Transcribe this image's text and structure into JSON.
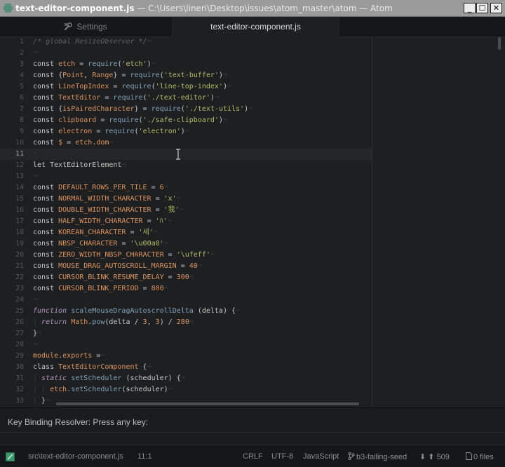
{
  "window": {
    "file_name": "text-editor-component.js",
    "title_rest": " — C:\\Users\\lineri\\Desktop\\issues\\atom_master\\atom — Atom",
    "minimize_glyph": "_",
    "maximize_glyph": "☐",
    "close_glyph": "✕"
  },
  "tabs": [
    {
      "label": "Settings",
      "icon": "wrench-icon",
      "active": false
    },
    {
      "label": "text-editor-component.js",
      "active": true
    }
  ],
  "editor": {
    "current_line": 11,
    "line_numbers": [
      "1",
      "2",
      "3",
      "4",
      "5",
      "6",
      "7",
      "8",
      "9",
      "10",
      "11",
      "12",
      "13",
      "14",
      "15",
      "16",
      "17",
      "18",
      "19",
      "20",
      "21",
      "22",
      "23",
      "24",
      "25",
      "26",
      "27",
      "28",
      "29",
      "30",
      "31",
      "32",
      "33"
    ],
    "lines": [
      [
        [
          "cm",
          "/* global ResizeObserver */"
        ],
        [
          "inv",
          "¬"
        ]
      ],
      [
        [
          "inv",
          "¬"
        ]
      ],
      [
        [
          "pl",
          "const "
        ],
        [
          "var",
          "etch"
        ],
        [
          "pl",
          " = "
        ],
        [
          "fn",
          "require"
        ],
        [
          "pl",
          "("
        ],
        [
          "str",
          "'etch'"
        ],
        [
          "pl",
          ")"
        ],
        [
          "inv",
          "¬"
        ]
      ],
      [
        [
          "pl",
          "const {"
        ],
        [
          "var",
          "Point"
        ],
        [
          "pl",
          ", "
        ],
        [
          "var",
          "Range"
        ],
        [
          "pl",
          "} = "
        ],
        [
          "fn",
          "require"
        ],
        [
          "pl",
          "("
        ],
        [
          "str",
          "'text-buffer'"
        ],
        [
          "pl",
          ")"
        ],
        [
          "inv",
          "¬"
        ]
      ],
      [
        [
          "pl",
          "const "
        ],
        [
          "var",
          "LineTopIndex"
        ],
        [
          "pl",
          " = "
        ],
        [
          "fn",
          "require"
        ],
        [
          "pl",
          "("
        ],
        [
          "str",
          "'line-top-index'"
        ],
        [
          "pl",
          ")"
        ],
        [
          "inv",
          "¬"
        ]
      ],
      [
        [
          "pl",
          "const "
        ],
        [
          "var",
          "TextEditor"
        ],
        [
          "pl",
          " = "
        ],
        [
          "fn",
          "require"
        ],
        [
          "pl",
          "("
        ],
        [
          "str",
          "'./text-editor'"
        ],
        [
          "pl",
          ")"
        ],
        [
          "inv",
          "¬"
        ]
      ],
      [
        [
          "pl",
          "const {"
        ],
        [
          "var",
          "isPairedCharacter"
        ],
        [
          "pl",
          "} = "
        ],
        [
          "fn",
          "require"
        ],
        [
          "pl",
          "("
        ],
        [
          "str",
          "'./text-utils'"
        ],
        [
          "pl",
          ")"
        ],
        [
          "inv",
          "¬"
        ]
      ],
      [
        [
          "pl",
          "const "
        ],
        [
          "var",
          "clipboard"
        ],
        [
          "pl",
          " = "
        ],
        [
          "fn",
          "require"
        ],
        [
          "pl",
          "("
        ],
        [
          "str",
          "'./safe-clipboard'"
        ],
        [
          "pl",
          ")"
        ],
        [
          "inv",
          "¬"
        ]
      ],
      [
        [
          "pl",
          "const "
        ],
        [
          "var",
          "electron"
        ],
        [
          "pl",
          " = "
        ],
        [
          "fn",
          "require"
        ],
        [
          "pl",
          "("
        ],
        [
          "str",
          "'electron'"
        ],
        [
          "pl",
          ")"
        ],
        [
          "inv",
          "¬"
        ]
      ],
      [
        [
          "pl",
          "const "
        ],
        [
          "var",
          "$"
        ],
        [
          "pl",
          " = "
        ],
        [
          "var",
          "etch"
        ],
        [
          "pl",
          "."
        ],
        [
          "var",
          "dom"
        ],
        [
          "inv",
          "¬"
        ]
      ],
      [
        [
          "inv",
          "¬"
        ]
      ],
      [
        [
          "pl",
          "let TextEditorElement"
        ],
        [
          "inv",
          "¬"
        ]
      ],
      [
        [
          "inv",
          "¬"
        ]
      ],
      [
        [
          "pl",
          "const "
        ],
        [
          "var",
          "DEFAULT_ROWS_PER_TILE"
        ],
        [
          "pl",
          " = "
        ],
        [
          "var",
          "6"
        ],
        [
          "inv",
          "¬"
        ]
      ],
      [
        [
          "pl",
          "const "
        ],
        [
          "var",
          "NORMAL_WIDTH_CHARACTER"
        ],
        [
          "pl",
          " = "
        ],
        [
          "str",
          "'x'"
        ],
        [
          "inv",
          "¬"
        ]
      ],
      [
        [
          "pl",
          "const "
        ],
        [
          "var",
          "DOUBLE_WIDTH_CHARACTER"
        ],
        [
          "pl",
          " = "
        ],
        [
          "str",
          "'我'"
        ],
        [
          "inv",
          "¬"
        ]
      ],
      [
        [
          "pl",
          "const "
        ],
        [
          "var",
          "HALF_WIDTH_CHARACTER"
        ],
        [
          "pl",
          " = "
        ],
        [
          "str",
          "'ﾊ'"
        ],
        [
          "inv",
          "¬"
        ]
      ],
      [
        [
          "pl",
          "const "
        ],
        [
          "var",
          "KOREAN_CHARACTER"
        ],
        [
          "pl",
          " = "
        ],
        [
          "str",
          "'세'"
        ],
        [
          "inv",
          "¬"
        ]
      ],
      [
        [
          "pl",
          "const "
        ],
        [
          "var",
          "NBSP_CHARACTER"
        ],
        [
          "pl",
          " = "
        ],
        [
          "str",
          "'\\u00a0'"
        ],
        [
          "inv",
          "¬"
        ]
      ],
      [
        [
          "pl",
          "const "
        ],
        [
          "var",
          "ZERO_WIDTH_NBSP_CHARACTER"
        ],
        [
          "pl",
          " = "
        ],
        [
          "str",
          "'\\ufeff'"
        ],
        [
          "inv",
          "¬"
        ]
      ],
      [
        [
          "pl",
          "const "
        ],
        [
          "var",
          "MOUSE_DRAG_AUTOSCROLL_MARGIN"
        ],
        [
          "pl",
          " = "
        ],
        [
          "var",
          "40"
        ],
        [
          "inv",
          "¬"
        ]
      ],
      [
        [
          "pl",
          "const "
        ],
        [
          "var",
          "CURSOR_BLINK_RESUME_DELAY"
        ],
        [
          "pl",
          " = "
        ],
        [
          "var",
          "300"
        ],
        [
          "inv",
          "¬"
        ]
      ],
      [
        [
          "pl",
          "const "
        ],
        [
          "var",
          "CURSOR_BLINK_PERIOD"
        ],
        [
          "pl",
          " = "
        ],
        [
          "var",
          "800"
        ],
        [
          "inv",
          "¬"
        ]
      ],
      [
        [
          "inv",
          "¬"
        ]
      ],
      [
        [
          "it",
          "function "
        ],
        [
          "fn",
          "scaleMouseDragAutoscrollDelta"
        ],
        [
          "pl",
          " (delta) {"
        ],
        [
          "inv",
          "¬"
        ]
      ],
      [
        [
          "inv",
          "| "
        ],
        [
          "it",
          "return "
        ],
        [
          "var",
          "Math"
        ],
        [
          "pl",
          "."
        ],
        [
          "fn",
          "pow"
        ],
        [
          "pl",
          "(delta / "
        ],
        [
          "var",
          "3"
        ],
        [
          "pl",
          ", "
        ],
        [
          "var",
          "3"
        ],
        [
          "pl",
          ") / "
        ],
        [
          "var",
          "280"
        ],
        [
          "inv",
          "¬"
        ]
      ],
      [
        [
          "pl",
          "}"
        ],
        [
          "inv",
          "¬"
        ]
      ],
      [
        [
          "inv",
          "¬"
        ]
      ],
      [
        [
          "var",
          "module"
        ],
        [
          "pl",
          "."
        ],
        [
          "var",
          "exports"
        ],
        [
          "pl",
          " ="
        ],
        [
          "inv",
          "¬"
        ]
      ],
      [
        [
          "pl",
          "class "
        ],
        [
          "var",
          "TextEditorComponent"
        ],
        [
          "pl",
          " {"
        ],
        [
          "inv",
          "¬"
        ]
      ],
      [
        [
          "inv",
          "| "
        ],
        [
          "it",
          "static "
        ],
        [
          "fn",
          "setScheduler"
        ],
        [
          "pl",
          " (scheduler) {"
        ],
        [
          "inv",
          "¬"
        ]
      ],
      [
        [
          "inv",
          "| | "
        ],
        [
          "var",
          "etch"
        ],
        [
          "pl",
          "."
        ],
        [
          "fn",
          "setScheduler"
        ],
        [
          "pl",
          "(scheduler)"
        ],
        [
          "inv",
          "¬"
        ]
      ],
      [
        [
          "inv",
          "| "
        ],
        [
          "pl",
          "}"
        ],
        [
          "inv",
          "¬"
        ]
      ]
    ]
  },
  "key_binding_resolver": {
    "text": "Key Binding Resolver: Press any key:"
  },
  "status_bar": {
    "file_path": "src\\text-editor-component.js",
    "cursor_position": "11:1",
    "line_ending": "CRLF",
    "encoding": "UTF-8",
    "grammar": "JavaScript",
    "branch": "b3-failing-seed",
    "commits_ahead": "509",
    "files_label": "0 files"
  },
  "colors": {
    "editor_bg": "#1d1f21",
    "keyword_orange": "#de935f",
    "string_green": "#b5bd68",
    "function_blue": "#81a2be",
    "italic_purple": "#b294bb"
  }
}
